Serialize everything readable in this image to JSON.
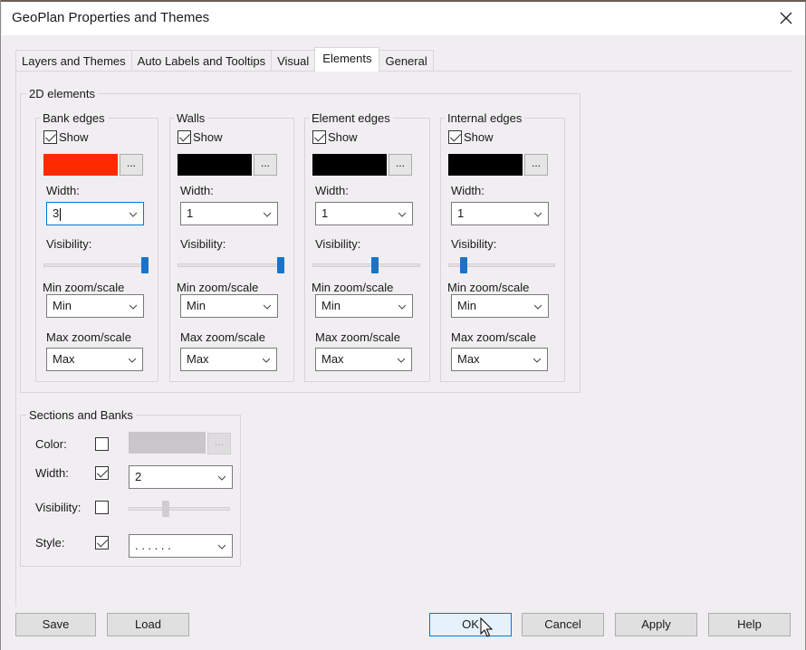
{
  "window": {
    "title": "GeoPlan Properties and Themes",
    "close_icon": "close-icon"
  },
  "tabs": [
    {
      "label": "Layers and Themes",
      "active": false
    },
    {
      "label": "Auto Labels and Tooltips",
      "active": false
    },
    {
      "label": "Visual",
      "active": false
    },
    {
      "label": "Elements",
      "active": true
    },
    {
      "label": "General",
      "active": false
    }
  ],
  "elements_2d": {
    "legend": "2D elements",
    "groups": [
      {
        "title": "Bank edges",
        "show_label": "Show",
        "show_checked": true,
        "color": "#ff2a00",
        "dots_label": "...",
        "width_label": "Width:",
        "width_value": "3",
        "visibility_label": "Visibility:",
        "visibility_value": 1.0,
        "min_label": "Min zoom/scale",
        "min_value": "Min",
        "max_label": "Max zoom/scale",
        "max_value": "Max"
      },
      {
        "title": "Walls",
        "show_label": "Show",
        "show_checked": true,
        "color": "#000000",
        "dots_label": "...",
        "width_label": "Width:",
        "width_value": "1",
        "visibility_label": "Visibility:",
        "visibility_value": 1.0,
        "min_label": "Min zoom/scale",
        "min_value": "Min",
        "max_label": "Max zoom/scale",
        "max_value": "Max"
      },
      {
        "title": "Element edges",
        "show_label": "Show",
        "show_checked": true,
        "color": "#000000",
        "dots_label": "...",
        "width_label": "Width:",
        "width_value": "1",
        "visibility_label": "Visibility:",
        "visibility_value": 0.6,
        "min_label": "Min zoom/scale",
        "min_value": "Min",
        "max_label": "Max zoom/scale",
        "max_value": "Max"
      },
      {
        "title": "Internal edges",
        "show_label": "Show",
        "show_checked": true,
        "color": "#000000",
        "dots_label": "...",
        "width_label": "Width:",
        "width_value": "1",
        "visibility_label": "Visibility:",
        "visibility_value": 0.15,
        "min_label": "Min zoom/scale",
        "min_value": "Min",
        "max_label": "Max zoom/scale",
        "max_value": "Max"
      }
    ]
  },
  "sections_banks": {
    "legend": "Sections and Banks",
    "color_label": "Color:",
    "color_checked": false,
    "color_value": "#c8c6c8",
    "dots_label": "...",
    "width_label": "Width:",
    "width_checked": true,
    "width_value": "2",
    "visibility_label": "Visibility:",
    "visibility_checked": false,
    "visibility_value": 0.38,
    "style_label": "Style:",
    "style_checked": true,
    "style_value": ". . . . . ."
  },
  "buttons": {
    "save": "Save",
    "load": "Load",
    "ok": "OK",
    "cancel": "Cancel",
    "apply": "Apply",
    "help": "Help"
  }
}
